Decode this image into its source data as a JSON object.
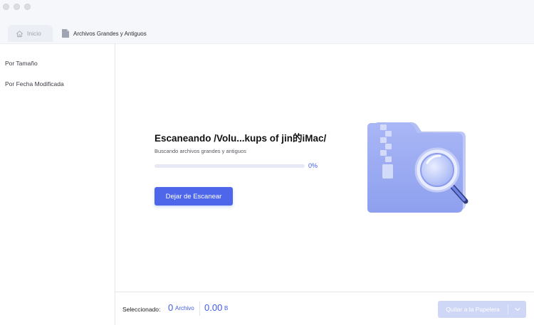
{
  "window": {
    "traffic_lights": [
      "close",
      "minimize",
      "zoom"
    ]
  },
  "tabs": [
    {
      "label": "Inicio",
      "icon": "home-icon"
    },
    {
      "label": "Archivos Grandes y Antiguos",
      "icon": "document-icon"
    }
  ],
  "sidebar": {
    "items": [
      {
        "label": "Por Tamaño"
      },
      {
        "label": "Por Fecha Modificada"
      }
    ]
  },
  "scan": {
    "title": "Escaneando /Volu...kups of jin的iMac/",
    "subtitle": "Buscando archivos grandes y antiguos",
    "progress_percent": 0,
    "progress_label": "0%",
    "stop_button": "Dejar de Escanear"
  },
  "footer": {
    "selected_label": "Seleccionado:",
    "file_count": "0",
    "file_unit": "Archivo",
    "size_value": "0.00",
    "size_unit": "B",
    "trash_button": "Quitar a la Papelera"
  },
  "colors": {
    "accent": "#4e66ea",
    "accent_text": "#3f5ce4",
    "disabled_button": "#cfd7f7",
    "topbar": "#f6f7fb"
  }
}
